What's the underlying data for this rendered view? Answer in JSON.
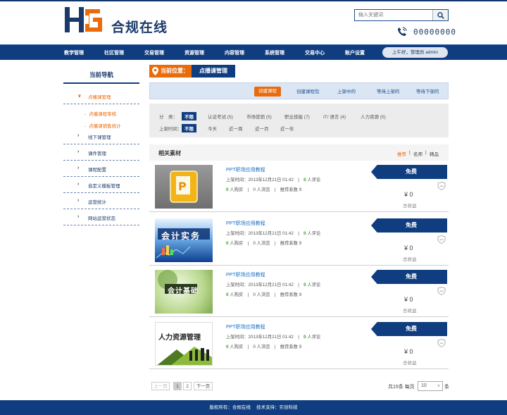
{
  "header": {
    "site_name": "合规在线",
    "logo_text": "HG",
    "search": {
      "placeholder": "输入关键词",
      "value": ""
    },
    "phone": "00000000"
  },
  "nav": {
    "items": [
      "教学管理",
      "社区管理",
      "交易管理",
      "资源管理",
      "内容管理",
      "系统管理",
      "交易中心",
      "账户设置"
    ],
    "greeting": "上午好，管理员 admin"
  },
  "sidebar": {
    "title": "当前导航",
    "items": [
      {
        "label": "点播课管理",
        "active": true
      },
      {
        "label": "线下课管理"
      },
      {
        "label": "课件管理"
      },
      {
        "label": "课程配置"
      },
      {
        "label": "自定义模板管理"
      },
      {
        "label": "运营统计"
      },
      {
        "label": "网站运营状态"
      }
    ],
    "subitems": [
      "点播课程审核",
      "点播课销售统计"
    ]
  },
  "location": {
    "prefix": "当前位置：",
    "page": "点播课管理"
  },
  "tabs": [
    {
      "label": "创建课程",
      "active": true
    },
    {
      "label": "创建课程包"
    },
    {
      "label": "上架中的"
    },
    {
      "label": "等待上架的"
    },
    {
      "label": "等待下架的"
    }
  ],
  "filters": {
    "category_label": "分　类：",
    "categories": [
      "不限",
      "认证考试 (5)",
      "市场营销 (5)",
      "职业技能 (7)",
      "IT/ 语言 (4)",
      "人力资源 (5)"
    ],
    "time_label": "上架时间：",
    "times": [
      "不限",
      "今天",
      "近一周",
      "近一月",
      "近一年"
    ]
  },
  "materials": {
    "title": "相关素材",
    "sorts": [
      "推荐",
      "名师",
      "精品"
    ],
    "items": [
      {
        "title": "PPT职场应用教程",
        "date": "上架时间：2013年12月21日 01:42",
        "comments": "0",
        "comments_label": "人评论",
        "buys": "0",
        "buys_label": "人购买",
        "views": "0 人浏览",
        "score": "推荐系数 9",
        "badge": "免费",
        "price": "¥ 0",
        "income": "总收益",
        "thumb_text": ""
      },
      {
        "title": "PPT职场应用教程",
        "date": "上架时间：2013年12月21日 01:42",
        "comments": "0",
        "comments_label": "人评论",
        "buys": "0",
        "buys_label": "人购买",
        "views": "0 人浏览",
        "score": "推荐系数 9",
        "badge": "免费",
        "price": "¥ 0",
        "income": "总收益",
        "thumb_text": "会计实务"
      },
      {
        "title": "PPT职场应用教程",
        "date": "上架时间：2013年12月21日 01:42",
        "comments": "0",
        "comments_label": "人评论",
        "buys": "0",
        "buys_label": "人购买",
        "views": "0 人浏览",
        "score": "推荐系数 9",
        "badge": "免费",
        "price": "¥ 0",
        "income": "总收益",
        "thumb_text": "会计基础"
      },
      {
        "title": "PPT职场应用教程",
        "date": "上架时间：2013年12月21日 01:42",
        "comments": "0",
        "comments_label": "人评论",
        "buys": "0",
        "buys_label": "人购买",
        "views": "0 人浏览",
        "score": "推荐系数 9",
        "badge": "免费",
        "price": "¥ 0",
        "income": "总收益",
        "thumb_text": "人力资源管理"
      }
    ]
  },
  "pager": {
    "prev": "上一页",
    "pages": [
      "1",
      "2"
    ],
    "next": "下一页",
    "total": "共15条 每页",
    "per_page": "10",
    "unit": "条"
  },
  "footer": {
    "text": "版权所有：合规在线　 技术支持：实创科技"
  },
  "colors": {
    "brand": "#0f3d80",
    "accent": "#e96b0c",
    "green": "#3a9b2c"
  }
}
